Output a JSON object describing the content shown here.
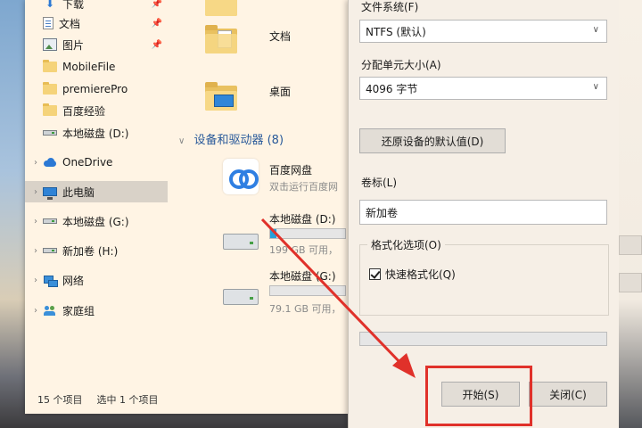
{
  "explorer": {
    "nav": [
      {
        "label": "下载",
        "icon": "download-icon",
        "pinned": true
      },
      {
        "label": "文档",
        "icon": "document-icon",
        "pinned": true
      },
      {
        "label": "图片",
        "icon": "picture-icon",
        "pinned": true
      },
      {
        "label": "MobileFile",
        "icon": "folder-icon"
      },
      {
        "label": "premierePro",
        "icon": "folder-icon"
      },
      {
        "label": "百度经验",
        "icon": "folder-icon"
      },
      {
        "label": "本地磁盘 (D:)",
        "icon": "drive-icon"
      },
      {
        "label": "OneDrive",
        "icon": "onedrive-icon"
      },
      {
        "label": "此电脑",
        "icon": "this-pc-icon",
        "selected": true
      },
      {
        "label": "本地磁盘 (G:)",
        "icon": "drive-icon"
      },
      {
        "label": "新加卷 (H:)",
        "icon": "drive-icon"
      },
      {
        "label": "网络",
        "icon": "network-icon"
      },
      {
        "label": "家庭组",
        "icon": "homegroup-icon"
      }
    ],
    "folders": [
      {
        "label": "文档"
      },
      {
        "label": "桌面"
      }
    ],
    "section_title": "设备和驱动器 (8)",
    "devices": [
      {
        "name": "百度网盘",
        "sub": "双击运行百度网"
      },
      {
        "name": "本地磁盘 (D:)",
        "sub": "199 GB 可用，",
        "fill": 0.08
      },
      {
        "name": "本地磁盘 (G:)",
        "sub": "79.1 GB 可用，",
        "fill": 0.0
      }
    ],
    "status": {
      "count": "15 个项目",
      "selected": "选中 1 个项目"
    }
  },
  "dialog": {
    "fs_label": "文件系统(F)",
    "fs_value": "NTFS (默认)",
    "alloc_label": "分配单元大小(A)",
    "alloc_value": "4096 字节",
    "restore_button": "还原设备的默认值(D)",
    "volume_label": "卷标(L)",
    "volume_value": "新加卷",
    "options_title": "格式化选项(O)",
    "quick_format": "快速格式化(Q)",
    "quick_format_checked": true,
    "progress": 0,
    "start_button": "开始(S)",
    "close_button": "关闭(C)"
  },
  "annotation_color": "#e0312a"
}
